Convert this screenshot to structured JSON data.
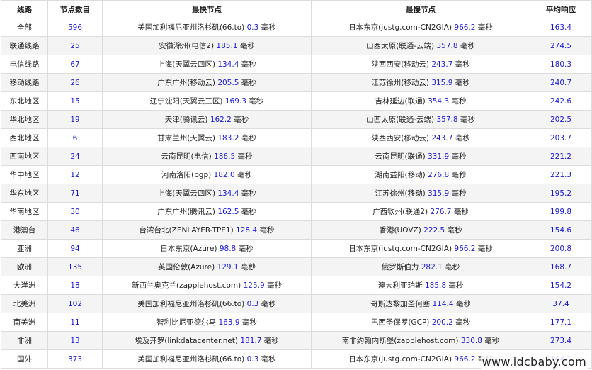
{
  "headers": [
    "线路",
    "节点数目",
    "最快节点",
    "最慢节点",
    "平均响应"
  ],
  "unit": "毫秒",
  "rows": [
    {
      "line": "全部",
      "count": "596",
      "fast_name": "美国加利福尼亚州洛杉矶(66.to)",
      "fast_ms": "0.3",
      "slow_name": "日本东京(justg.com-CN2GIA)",
      "slow_ms": "966.2",
      "avg": "163.4"
    },
    {
      "line": "联通线路",
      "count": "25",
      "fast_name": "安徽滁州(电信2)",
      "fast_ms": "185.1",
      "slow_name": "山西太原(联通-云端)",
      "slow_ms": "357.8",
      "avg": "274.5"
    },
    {
      "line": "电信线路",
      "count": "67",
      "fast_name": "上海(天翼云四区)",
      "fast_ms": "134.4",
      "slow_name": "陕西西安(移动云)",
      "slow_ms": "243.7",
      "avg": "180.3"
    },
    {
      "line": "移动线路",
      "count": "26",
      "fast_name": "广东广州(移动云)",
      "fast_ms": "205.5",
      "slow_name": "江苏徐州(移动云)",
      "slow_ms": "315.9",
      "avg": "240.7"
    },
    {
      "line": "东北地区",
      "count": "15",
      "fast_name": "辽宁沈阳(天翼云三区)",
      "fast_ms": "169.3",
      "slow_name": "吉林延边(联通)",
      "slow_ms": "354.3",
      "avg": "242.6"
    },
    {
      "line": "华北地区",
      "count": "19",
      "fast_name": "天津(腾讯云)",
      "fast_ms": "162.2",
      "slow_name": "山西太原(联通-云端)",
      "slow_ms": "357.8",
      "avg": "202.5"
    },
    {
      "line": "西北地区",
      "count": "6",
      "fast_name": "甘肃兰州(天翼云)",
      "fast_ms": "183.2",
      "slow_name": "陕西西安(移动云)",
      "slow_ms": "243.7",
      "avg": "203.7"
    },
    {
      "line": "西南地区",
      "count": "24",
      "fast_name": "云南昆明(电信)",
      "fast_ms": "186.5",
      "slow_name": "云南昆明(联通)",
      "slow_ms": "331.9",
      "avg": "221.2"
    },
    {
      "line": "华中地区",
      "count": "12",
      "fast_name": "河南洛阳(bgp)",
      "fast_ms": "182.0",
      "slow_name": "湖南益阳(移动)",
      "slow_ms": "276.8",
      "avg": "221.3"
    },
    {
      "line": "华东地区",
      "count": "71",
      "fast_name": "上海(天翼云四区)",
      "fast_ms": "134.4",
      "slow_name": "江苏徐州(移动)",
      "slow_ms": "315.9",
      "avg": "195.2"
    },
    {
      "line": "华南地区",
      "count": "30",
      "fast_name": "广东广州(腾讯云)",
      "fast_ms": "162.5",
      "slow_name": "广西钦州(联通2)",
      "slow_ms": "276.7",
      "avg": "199.8"
    },
    {
      "line": "港澳台",
      "count": "46",
      "fast_name": "台湾台北(ZENLAYER-TPE1)",
      "fast_ms": "128.4",
      "slow_name": "香港(UOVZ)",
      "slow_ms": "222.5",
      "avg": "154.6"
    },
    {
      "line": "亚洲",
      "count": "94",
      "fast_name": "日本东京(Azure)",
      "fast_ms": "98.8",
      "slow_name": "日本东京(justg.com-CN2GIA)",
      "slow_ms": "966.2",
      "avg": "200.8"
    },
    {
      "line": "欧洲",
      "count": "135",
      "fast_name": "英国伦敦(Azure)",
      "fast_ms": "129.1",
      "slow_name": "俄罗斯伯力",
      "slow_ms": "282.1",
      "avg": "168.7"
    },
    {
      "line": "大洋洲",
      "count": "18",
      "fast_name": "新西兰奥克兰(zappiehost.com)",
      "fast_ms": "125.9",
      "slow_name": "澳大利亚珀斯",
      "slow_ms": "185.8",
      "avg": "154.2"
    },
    {
      "line": "北美洲",
      "count": "102",
      "fast_name": "美国加利福尼亚州洛杉矶(66.to)",
      "fast_ms": "0.3",
      "slow_name": "哥斯达黎加圣何塞",
      "slow_ms": "114.4",
      "avg": "37.4"
    },
    {
      "line": "南美洲",
      "count": "11",
      "fast_name": "智利比尼亚德尔马",
      "fast_ms": "163.9",
      "slow_name": "巴西圣保罗(GCP)",
      "slow_ms": "200.2",
      "avg": "177.1"
    },
    {
      "line": "非洲",
      "count": "13",
      "fast_name": "埃及开罗(linkdatacenter.net)",
      "fast_ms": "181.7",
      "slow_name": "南非约翰内斯堡(zappiehost.com)",
      "slow_ms": "330.8",
      "avg": "273.4"
    },
    {
      "line": "国外",
      "count": "373",
      "fast_name": "美国加利福尼亚州洛杉矶(66.to)",
      "fast_ms": "0.3",
      "slow_name": "日本东京(justg.com-CN2GIA)",
      "slow_ms": "966.2",
      "avg": "144.1"
    }
  ],
  "watermark": "www.idcbaby.com",
  "colors": {
    "number": "#1a1ad6",
    "text": "#222222",
    "border": "#dcdcdc",
    "stripe": "#f4f4f4"
  }
}
